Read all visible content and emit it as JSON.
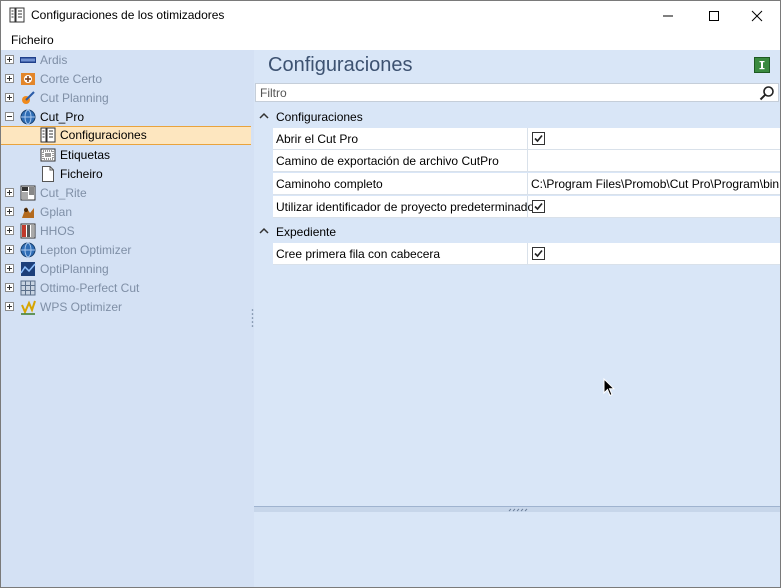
{
  "window": {
    "title": "Configuraciones de los otimizadores",
    "app_icon": "settings-list-icon",
    "controls": [
      "minimize-icon",
      "maximize-icon",
      "close-icon"
    ]
  },
  "menu": {
    "items": [
      "Ficheiro"
    ]
  },
  "tree": {
    "items": [
      {
        "label": "Ardis",
        "icon": "ardis-logo-icon",
        "expanded": false,
        "dim": true
      },
      {
        "label": "Corte Certo",
        "icon": "corte-certo-icon",
        "expanded": false,
        "dim": true
      },
      {
        "label": "Cut Planning",
        "icon": "cut-planning-icon",
        "expanded": false,
        "dim": true
      },
      {
        "label": "Cut_Pro",
        "icon": "cut-pro-globe-icon",
        "expanded": true,
        "dim": false,
        "children": [
          {
            "label": "Configuraciones",
            "icon": "settings-list-icon",
            "selected": true
          },
          {
            "label": "Etiquetas",
            "icon": "label-icon"
          },
          {
            "label": "Ficheiro",
            "icon": "file-icon"
          }
        ]
      },
      {
        "label": "Cut_Rite",
        "icon": "cut-rite-icon",
        "expanded": false,
        "dim": true
      },
      {
        "label": "Gplan",
        "icon": "gplan-icon",
        "expanded": false,
        "dim": true
      },
      {
        "label": "HHOS",
        "icon": "hhos-icon",
        "expanded": false,
        "dim": true
      },
      {
        "label": "Lepton Optimizer",
        "icon": "lepton-globe-icon",
        "expanded": false,
        "dim": true
      },
      {
        "label": "OptiPlanning",
        "icon": "optiplanning-icon",
        "expanded": false,
        "dim": true
      },
      {
        "label": "Ottimo-Perfect Cut",
        "icon": "grid-icon",
        "expanded": false,
        "dim": true
      },
      {
        "label": "WPS Optimizer",
        "icon": "wps-icon",
        "expanded": false,
        "dim": true
      }
    ]
  },
  "panel": {
    "title": "Configuraciones",
    "action_icon": "info-icon",
    "filter_placeholder": "Filtro",
    "categories": [
      {
        "label": "Configuraciones",
        "props": [
          {
            "name": "Abrir el Cut Pro",
            "type": "check",
            "checked": true
          },
          {
            "name": "Camino de exportación de archivo CutPro",
            "type": "text",
            "value": ""
          },
          {
            "name": "Caminoho completo",
            "type": "text",
            "value": "C:\\Program Files\\Promob\\Cut Pro\\Program\\bin"
          },
          {
            "name": "Utilizar identificador de proyecto predeterminado",
            "type": "check",
            "checked": true
          }
        ]
      },
      {
        "label": "Expediente",
        "props": [
          {
            "name": "Cree primera fila con cabecera",
            "type": "check",
            "checked": true
          }
        ]
      }
    ]
  },
  "colors": {
    "left_bg": "#d4e1f4",
    "right_bg": "#d9e6f7",
    "selection_bg": "#fde6bf",
    "selection_border": "#e9a33c",
    "title_color": "#3d5271"
  }
}
